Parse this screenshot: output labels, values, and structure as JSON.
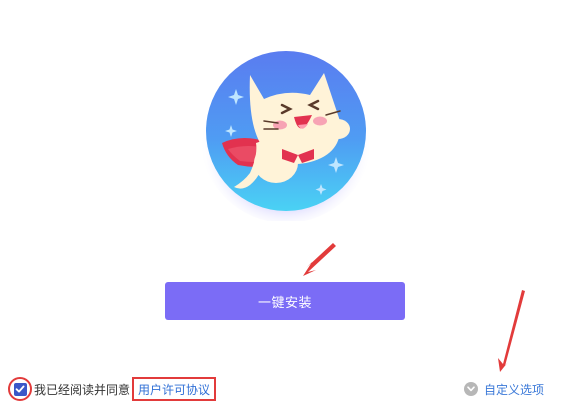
{
  "install": {
    "button_label": "一键安装"
  },
  "agreement": {
    "checked": true,
    "prefix_text": "我已经阅读并同意",
    "license_link": "用户许可协议"
  },
  "options": {
    "custom_label": "自定义选项"
  },
  "colors": {
    "accent": "#7b6cf6",
    "link": "#2f6fd6",
    "annotation": "#e23b3b",
    "checkbox": "#3a57c8"
  },
  "icons": {
    "mascot": "flying-cat-mascot",
    "check": "check-icon",
    "options": "chevron-down-circle-icon",
    "annotation": "red-arrow"
  }
}
